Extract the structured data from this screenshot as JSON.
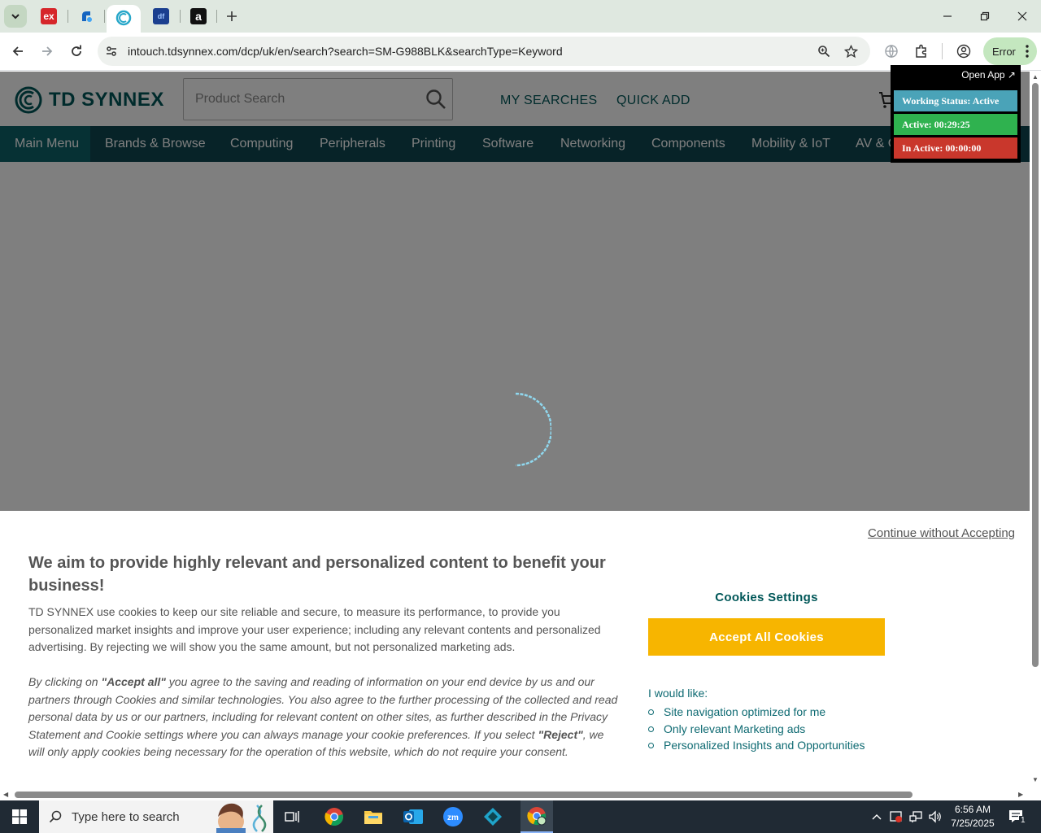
{
  "browser": {
    "tabs": [
      {
        "icon": "ex-favicon-icon",
        "label": "ex"
      },
      {
        "icon": "blue-app-favicon-icon",
        "label": ""
      },
      {
        "icon": "td-synnex-favicon-icon",
        "label": ""
      },
      {
        "icon": "df-favicon-icon",
        "label": "df"
      },
      {
        "icon": "amazon-favicon-icon",
        "label": "a"
      }
    ],
    "url": "intouch.tdsynnex.com/dcp/uk/en/search?search=SM-G988BLK&searchType=Keyword",
    "profile_status": "Error"
  },
  "site": {
    "logo_text": "TD SYNNEX",
    "search_placeholder": "Product Search",
    "my_searches": "MY SEARCHES",
    "quick_add": "QUICK ADD",
    "nav": [
      "Main Menu",
      "Brands & Browse",
      "Computing",
      "Peripherals",
      "Printing",
      "Software",
      "Networking",
      "Components",
      "Mobility & IoT",
      "AV & Collaboration"
    ]
  },
  "tracker": {
    "open_app": "Open App ↗",
    "status": "Working Status: Active",
    "active": "Active: 00:29:25",
    "inactive": "In Active: 00:00:00",
    "colors": {
      "status": "#4aa3b8",
      "active": "#2fb24f",
      "inactive": "#c9372c"
    }
  },
  "cookie": {
    "continue": "Continue without Accepting",
    "title": "We aim to provide highly relevant and personalized content to benefit your business!",
    "body": "TD SYNNEX use cookies to keep our site reliable and secure, to measure its performance, to provide you personalized market insights and improve your user experience; including any relevant contents and personalized advertising. By rejecting we will show you the same amount, but not personalized marketing ads.",
    "italic_1": "By clicking on ",
    "italic_accept": "\"Accept all\"",
    "italic_2": " you agree to the saving and reading of information on your end device by us and our partners through Cookies and similar technologies. You also agree to the further processing of the collected and read personal data by us or our partners, including for relevant content on other sites, as further described in the Privacy Statement and Cookie settings where you can always manage your cookie preferences. If you select ",
    "italic_reject": "\"Reject\"",
    "italic_3": ", we will only apply cookies being necessary for the operation of this website, which do not require your consent.",
    "settings": "Cookies Settings",
    "accept_all": "Accept All Cookies",
    "i_would_like": "I would like:",
    "options": [
      "Site navigation optimized for me",
      "Only relevant Marketing ads",
      "Personalized Insights and Opportunities"
    ],
    "accent": "#f7b500"
  },
  "taskbar": {
    "search_placeholder": "Type here to search",
    "time": "6:56 AM",
    "date": "7/25/2025",
    "notification_count": "1"
  }
}
